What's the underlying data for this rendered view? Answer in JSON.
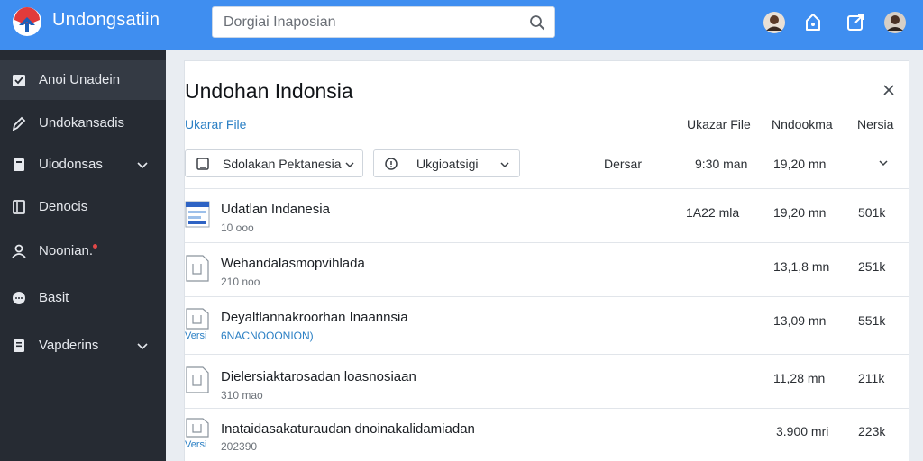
{
  "app": {
    "title": "Undongsatiin"
  },
  "search": {
    "placeholder": "Dorgiai Inaposian"
  },
  "sidebar": {
    "items": [
      {
        "label": "Anoi Unadein"
      },
      {
        "label": "Undokansadis"
      },
      {
        "label": "Uiodonsas"
      },
      {
        "label": "Denocis"
      },
      {
        "label": "Noonian."
      },
      {
        "label": "Basit"
      },
      {
        "label": "Vapderins"
      }
    ]
  },
  "panel": {
    "title": "Undohan Indonsia",
    "headers": {
      "file": "Ukarar File",
      "file2": "Ukazar File",
      "date": "Nndookma",
      "version": "Nersia"
    },
    "filters": {
      "dropdown1": "Sdolakan Pektanesia",
      "dropdown2": "Ukgioatsigi",
      "label": "Dersar",
      "time": "9:30 man",
      "date": "19,20 mn"
    },
    "rows": [
      {
        "name": "Udatlan Indanesia",
        "sub": "10 ooo",
        "col1": "1A22 mla",
        "date": "19,20 mn",
        "size": "501k"
      },
      {
        "name": "Wehandalasmopvihlada",
        "sub": "210 noo",
        "col1": "",
        "date": "13,1,8 mn",
        "size": "251k"
      },
      {
        "name": "Deyaltlannakroorhan Inaannsia",
        "sub": "6NACNOOONION)",
        "tag": "Versi",
        "col1": "",
        "date": "13,09 mn",
        "size": "551k"
      },
      {
        "name": "Dielersiaktarosadan loasnosiaan",
        "sub": "310 mao",
        "col1": "",
        "date": "11,28 mn",
        "size": "211k"
      },
      {
        "name": "Inataidasakaturaudan dnoinakalidamiadan",
        "sub": "202390",
        "tag": "Versi",
        "col1": "",
        "date": "3.900 mri",
        "size": "223k"
      }
    ]
  },
  "colors": {
    "topbar": "#3f8ef0",
    "sidebar": "#262b33",
    "accent": "#2a7fc4",
    "logo_red": "#e23b3b"
  },
  "icons": {
    "logo": "brand-logo",
    "search": "search-icon",
    "top": [
      "avatar-icon",
      "tag-icon",
      "share-icon",
      "user-avatar"
    ],
    "sidebar": [
      "box-check-icon",
      "pen-icon",
      "file-icon",
      "book-icon",
      "person-icon",
      "chat-icon",
      "document-icon"
    ]
  }
}
